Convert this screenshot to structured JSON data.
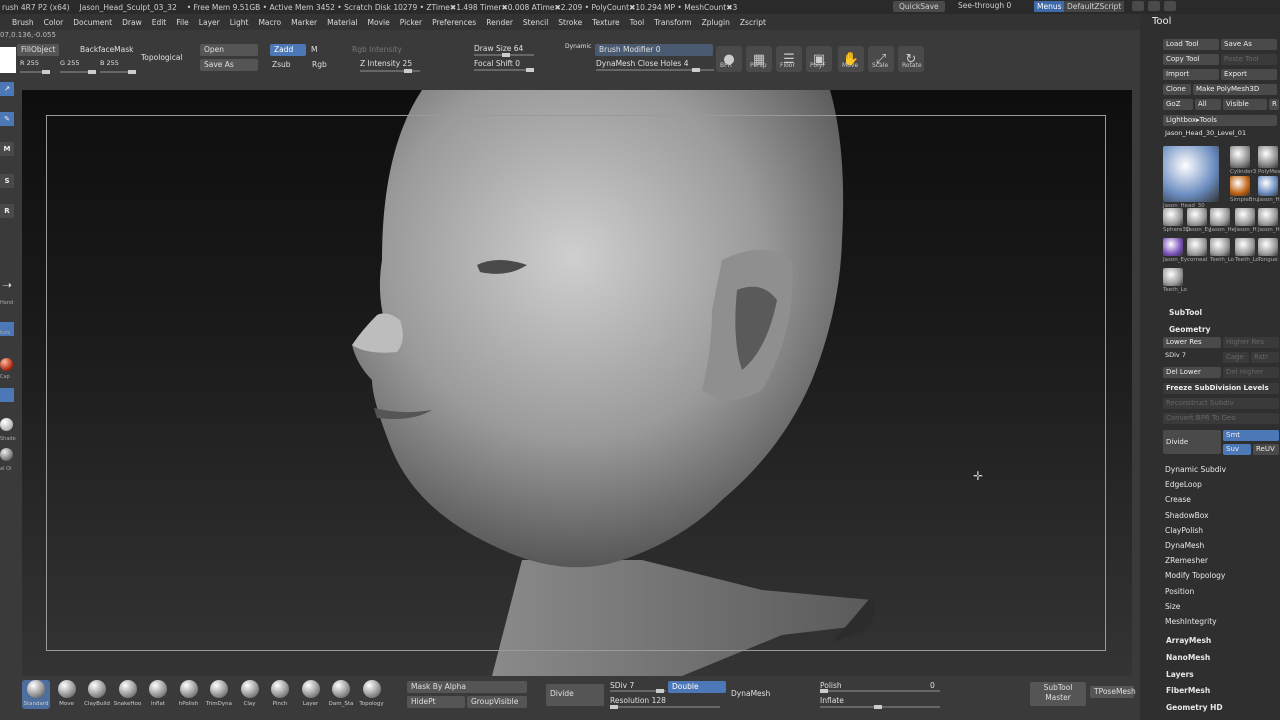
{
  "titlebar": {
    "app": "rush 4R7 P2 (x64)",
    "file": "Jason_Head_Sculpt_03_32",
    "stats": "• Free Mem 9.51GB • Active Mem 3452 • Scratch Disk 10279 • ZTime✖1.498 Timer✖0.008 ATime✖2.209 • PolyCount✖10.294 MP • MeshCount✖3",
    "quicksave": "QuickSave",
    "seethrough": "See-through  0",
    "menus": "Menus",
    "defaultscript": "DefaultZScript"
  },
  "menubar": [
    "Brush",
    "Color",
    "Document",
    "Draw",
    "Edit",
    "File",
    "Layer",
    "Light",
    "Macro",
    "Marker",
    "Material",
    "Movie",
    "Picker",
    "Preferences",
    "Render",
    "Stencil",
    "Stroke",
    "Texture",
    "Tool",
    "Transform",
    "Zplugin",
    "Zscript"
  ],
  "coord": "07,0.136,-0.055",
  "shelf": {
    "fillobject": "FillObject",
    "backfacemask": "BackfaceMask",
    "topological": "Topological",
    "r": "R 255",
    "g": "G 255",
    "b": "B 255",
    "open": "Open",
    "saveas": "Save As",
    "zadd": "Zadd",
    "m": "M",
    "zsub": "Zsub",
    "rgb": "Rgb",
    "rgbintensity": "Rgb Intensity",
    "zintensity": "Z Intensity 25",
    "drawsize": "Draw Size 64",
    "focalshift": "Focal Shift 0",
    "dynamic": "Dynamic",
    "brushmod": "Brush Modifier 0",
    "dynamesh": "DynaMesh Close Holes 4",
    "icons": [
      {
        "label": "BPR",
        "name": "bpr-icon"
      },
      {
        "label": "Persp",
        "name": "perspective-icon"
      },
      {
        "label": "Floor",
        "name": "floor-icon"
      },
      {
        "label": "PolyF",
        "name": "polyframe-icon"
      },
      {
        "label": "Move",
        "name": "move-icon"
      },
      {
        "label": "Scale",
        "name": "scale-icon"
      },
      {
        "label": "Rotate",
        "name": "rotate-icon"
      }
    ]
  },
  "leftstrip": [
    {
      "label": "M",
      "cap": "Move"
    },
    {
      "label": "S",
      "cap": "Scale"
    },
    {
      "label": "R",
      "cap": "Rotate"
    }
  ],
  "leftcaps": [
    "Hand",
    "ture",
    "Cap",
    "Shade",
    "al Ol"
  ],
  "bottom": {
    "brushes": [
      "Standard",
      "Move",
      "ClayBuild",
      "SnakeHoo",
      "Inflat",
      "hPolish",
      "TrimDyna",
      "Clay",
      "Pinch",
      "Layer",
      "Dam_Sta",
      "Topology"
    ],
    "maskbyalpha": "Mask By Alpha",
    "hidept": "HidePt",
    "groupvisible": "GroupVisible",
    "divide": "Divide",
    "sdiv": "SDiv 7",
    "double": "Double",
    "resolution": "Resolution 128",
    "dynamesh": "DynaMesh",
    "polish": "Polish",
    "inflate": "Inflate",
    "polish_val": "0",
    "subtoolmaster": "SubTool Master",
    "tposemesh": "TPoseMesh"
  },
  "rpanel": {
    "title": "Tool",
    "loadtool": "Load Tool",
    "saveas": "Save As",
    "copytool": "Copy Tool",
    "pastetool": "Paste Tool",
    "import": "Import",
    "export": "Export",
    "clone": "Clone",
    "makepoly": "Make PolyMesh3D",
    "goz": "GoZ",
    "all": "All",
    "visible": "Visible",
    "r": "R",
    "lightbox": "Lightbox▸Tools",
    "current": "Jason_Head_30_Level_01",
    "thumbs": [
      "Jason_Head_30",
      "Cylinder3",
      "PolyMes",
      "SimpleBru",
      "Jason_H",
      "Sphere3D",
      "Jason_Ey",
      "Jason_He",
      "Jason_H",
      "Jason_He",
      "Jason_Ey",
      "corneal",
      "Teeth_Lo",
      "Teeth_Lo",
      "Tongue",
      "Teeth_Lo"
    ],
    "subtool": "SubTool",
    "geometry": "Geometry",
    "lowerres": "Lower Res",
    "higherres": "Higher Res",
    "sdiv": "SDiv 7",
    "cage": "Cage",
    "rstr": "Rstr",
    "dellower": "Del Lower",
    "delhigher": "Del Higher",
    "freeze": "Freeze SubDivision Levels",
    "reconstruct": "Reconstruct Subdiv",
    "convertbpr": "Convert BPR To Geo",
    "divide": "Divide",
    "smt": "Smt",
    "suv": "Suv",
    "reluv": "ReUV",
    "items": [
      "Dynamic Subdiv",
      "EdgeLoop",
      "Crease",
      "ShadowBox",
      "ClayPolish",
      "DynaMesh",
      "ZRemesher",
      "Modify Topology",
      "Position",
      "Size",
      "MeshIntegrity"
    ],
    "sections": [
      "ArrayMesh",
      "NanoMesh",
      "Layers",
      "FiberMesh",
      "Geometry HD"
    ]
  },
  "colors": {
    "accent": "#4d78b8",
    "background": "#3a3a3a",
    "viewport_top": "#0e0e0e"
  }
}
